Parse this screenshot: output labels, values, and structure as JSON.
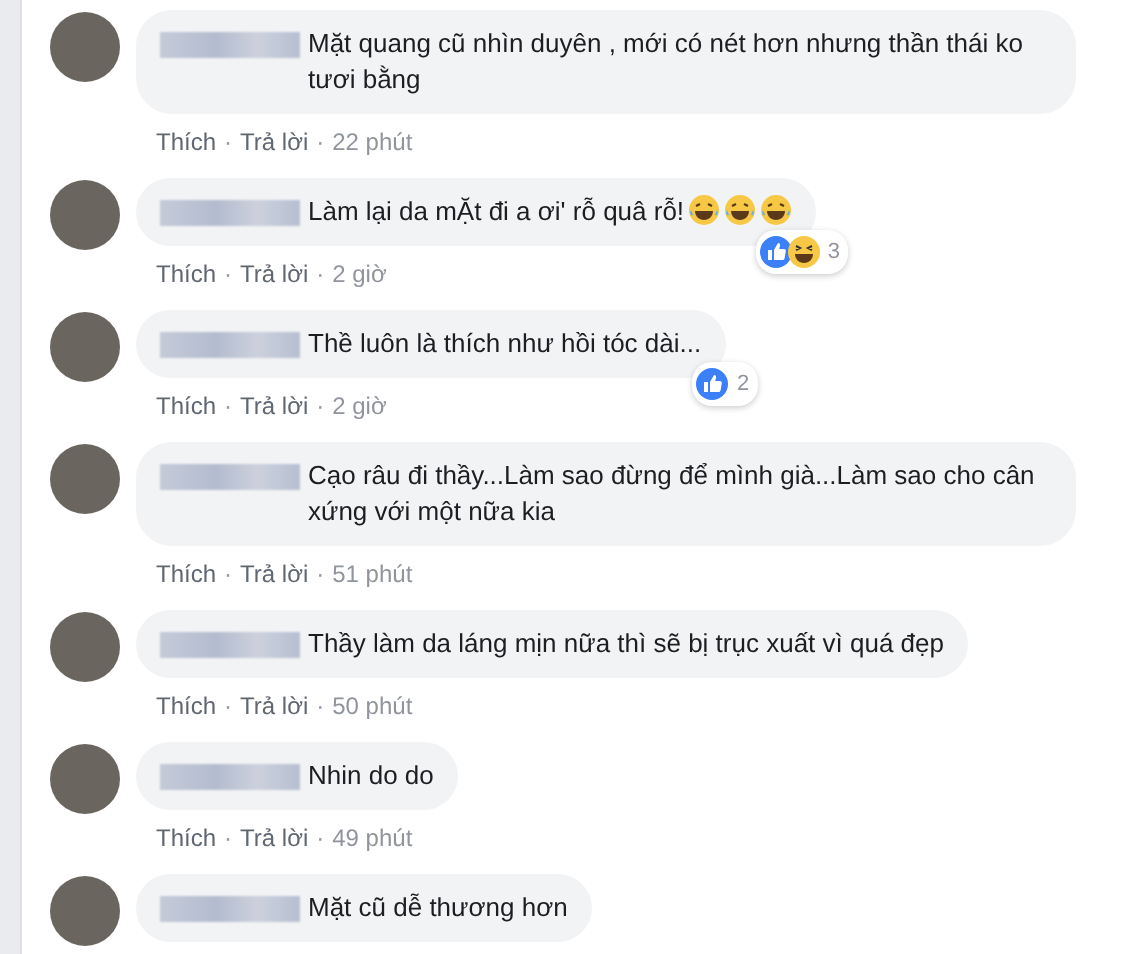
{
  "comments": [
    {
      "text": "Mặt quang cũ nhìn duyên , mới có nét hơn nhưng thần thái ko tươi bằng",
      "actions": [
        {
          "kind": "link",
          "text": "Thích"
        },
        {
          "kind": "sep",
          "text": "·"
        },
        {
          "kind": "link",
          "text": "Trả lời"
        },
        {
          "kind": "sep",
          "text": "·"
        },
        {
          "kind": "time",
          "text": "22 phút"
        }
      ]
    },
    {
      "text": "Làm lại da mẶt đi a ơi' rỗ quâ rỗ!",
      "emojis": [
        {
          "kind": "laugh"
        },
        {
          "kind": "laugh"
        },
        {
          "kind": "laugh"
        }
      ],
      "reactions": {
        "types": [
          {
            "kind": "like"
          },
          {
            "kind": "haha"
          }
        ],
        "count": "3"
      },
      "actions": [
        {
          "kind": "link",
          "text": "Thích"
        },
        {
          "kind": "sep",
          "text": "·"
        },
        {
          "kind": "link",
          "text": "Trả lời"
        },
        {
          "kind": "sep",
          "text": "·"
        },
        {
          "kind": "time",
          "text": "2 giờ"
        }
      ]
    },
    {
      "text": "Thề luôn là thích như hồi tóc dài...",
      "reactions": {
        "types": [
          {
            "kind": "like"
          }
        ],
        "count": "2"
      },
      "actions": [
        {
          "kind": "link",
          "text": "Thích"
        },
        {
          "kind": "sep",
          "text": "·"
        },
        {
          "kind": "link",
          "text": "Trả lời"
        },
        {
          "kind": "sep",
          "text": "·"
        },
        {
          "kind": "time",
          "text": "2 giờ"
        }
      ]
    },
    {
      "text": "Cạo râu đi thầy...Làm sao đừng để mình già...Làm sao cho cân xứng với một nữa kia",
      "actions": [
        {
          "kind": "link",
          "text": "Thích"
        },
        {
          "kind": "sep",
          "text": "·"
        },
        {
          "kind": "link",
          "text": "Trả lời"
        },
        {
          "kind": "sep",
          "text": "·"
        },
        {
          "kind": "time",
          "text": "51 phút"
        }
      ]
    },
    {
      "text": "Thầy làm da láng mịn nữa thì sẽ bị trục xuất vì quá đẹp",
      "actions": [
        {
          "kind": "link",
          "text": "Thích"
        },
        {
          "kind": "sep",
          "text": "·"
        },
        {
          "kind": "link",
          "text": "Trả lời"
        },
        {
          "kind": "sep",
          "text": "·"
        },
        {
          "kind": "time",
          "text": "50 phút"
        }
      ]
    },
    {
      "text": "Nhin do do",
      "actions": [
        {
          "kind": "link",
          "text": "Thích"
        },
        {
          "kind": "sep",
          "text": "·"
        },
        {
          "kind": "link",
          "text": "Trả lời"
        },
        {
          "kind": "sep",
          "text": "·"
        },
        {
          "kind": "time",
          "text": "49 phút"
        }
      ]
    },
    {
      "text": "Mặt cũ dễ thương hơn"
    }
  ]
}
